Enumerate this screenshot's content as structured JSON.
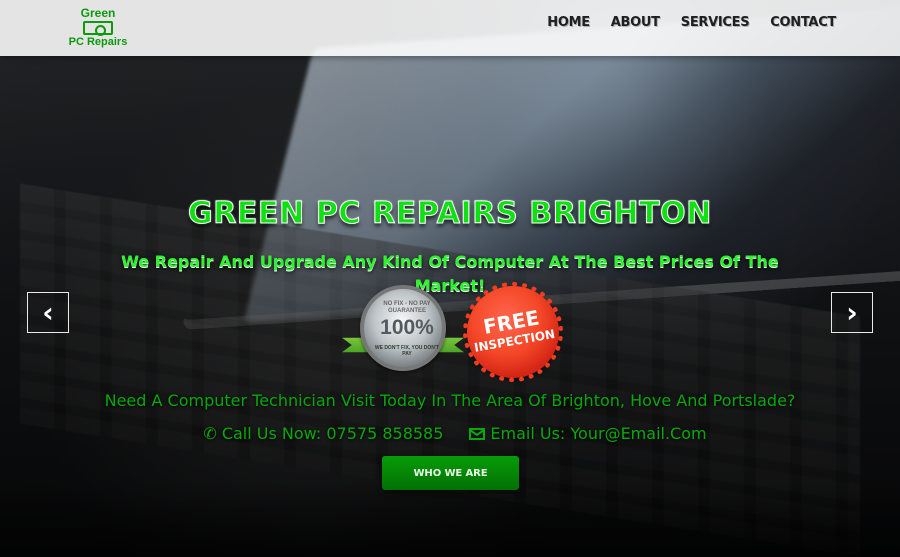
{
  "header": {
    "logo": {
      "line1": "Green",
      "line2": "PC Repairs",
      "icon": "computer-recycle-icon",
      "color": "#0b9a0b"
    },
    "nav_items": [
      {
        "label": "HOME"
      },
      {
        "label": "ABOUT"
      },
      {
        "label": "SERVICES"
      },
      {
        "label": "CONTACT"
      }
    ]
  },
  "hero": {
    "title": "GREEN PC REPAIRS BRIGHTON",
    "subtitle": "We Repair And Upgrade Any Kind Of Computer At The Best Prices Of The Market!",
    "previous_arrow": "‹",
    "next_arrow": "›",
    "badges": {
      "guarantee": {
        "top_text": "NO FIX - NO PAY GUARANTEE",
        "percent": "100%",
        "bottom_text": "WE DON'T FIX, YOU DON'T PAY"
      },
      "free_inspection": {
        "main": "FREE",
        "sub": "INSPECTION"
      }
    },
    "visit_text": "Need A Computer Technician Visit Today In The Area Of Brighton, Hove And Portslade?",
    "phone": {
      "icon": "phone-icon",
      "text": "Call Us Now: 07575 858585"
    },
    "email": {
      "icon": "envelope-icon",
      "text": "Email Us: Your@Email.Com"
    },
    "button_label": "WHO WE ARE"
  },
  "colors": {
    "accent_green": "#0ee011",
    "dark_green": "#07a80b",
    "button_green": "#079c08",
    "badge_red": "#f44727"
  }
}
